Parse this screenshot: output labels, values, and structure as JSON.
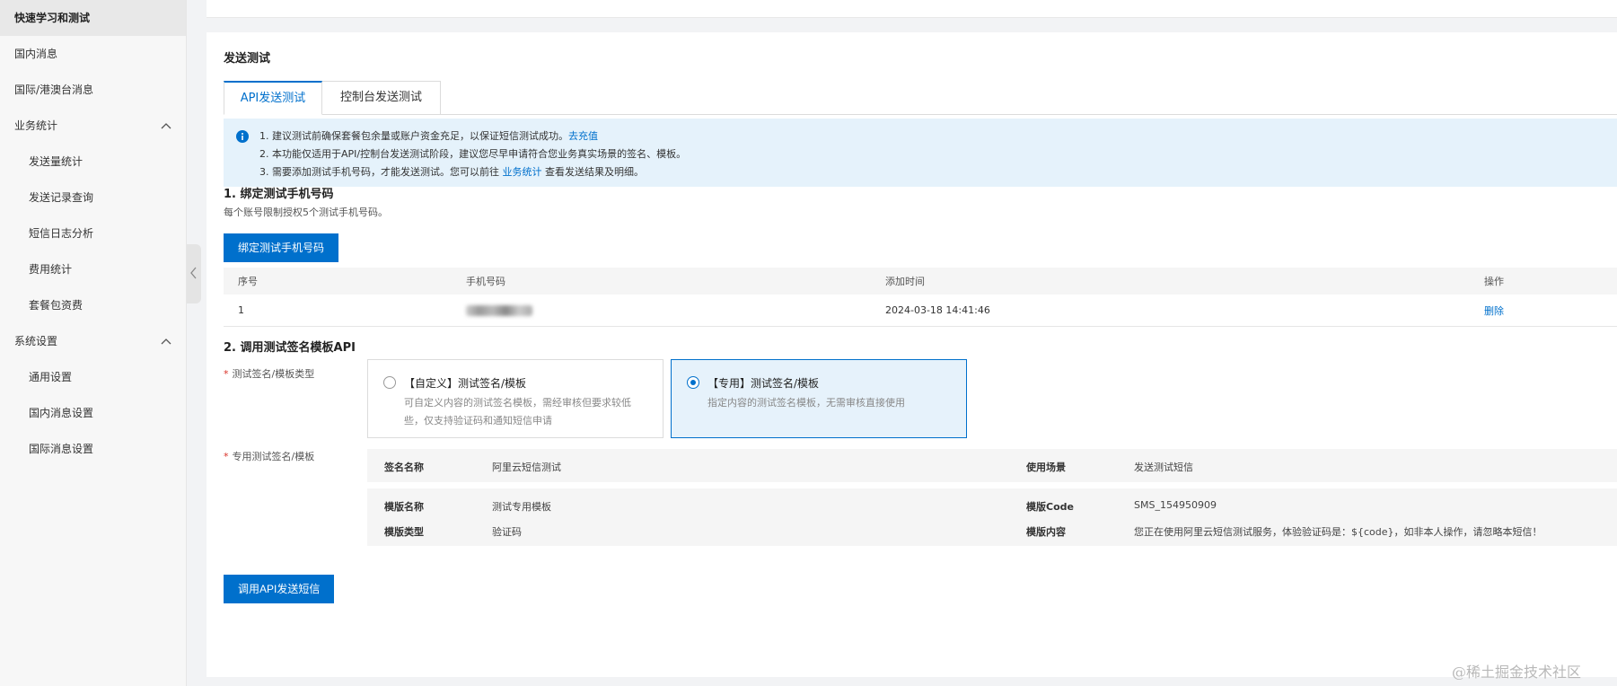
{
  "sidebar": {
    "items": [
      {
        "label": "快速学习和测试"
      },
      {
        "label": "国内消息"
      },
      {
        "label": "国际/港澳台消息"
      },
      {
        "label": "业务统计"
      },
      {
        "label": "发送量统计"
      },
      {
        "label": "发送记录查询"
      },
      {
        "label": "短信日志分析"
      },
      {
        "label": "费用统计"
      },
      {
        "label": "套餐包资费"
      },
      {
        "label": "系统设置"
      },
      {
        "label": "通用设置"
      },
      {
        "label": "国内消息设置"
      },
      {
        "label": "国际消息设置"
      }
    ]
  },
  "main": {
    "title": "发送测试",
    "tabs": [
      {
        "label": "API发送测试"
      },
      {
        "label": "控制台发送测试"
      }
    ],
    "notice": {
      "line1": "1. 建议测试前确保套餐包余量或账户资金充足，以保证短信测试成功。",
      "line1_link": "去充值",
      "line2": "2. 本功能仅适用于API/控制台发送测试阶段，建议您尽早申请符合您业务真实场景的签名、模板。",
      "line3_pre": "3. 需要添加测试手机号码，才能发送测试。您可以前往 ",
      "line3_link": "业务统计",
      "line3_post": " 查看发送结果及明细。"
    },
    "step1": {
      "title": "1. 绑定测试手机号码",
      "desc": "每个账号限制授权5个测试手机号码。",
      "button": "绑定测试手机号码",
      "table": {
        "headers": [
          "序号",
          "手机号码",
          "添加时间",
          "操作"
        ],
        "rows": [
          {
            "index": "1",
            "time": "2024-03-18 14:41:46",
            "action": "删除"
          }
        ]
      }
    },
    "step2": {
      "title": "2. 调用测试签名模板API",
      "type_label": "测试签名/模板类型",
      "options": [
        {
          "title": "【自定义】测试签名/模板",
          "desc_line1": "可自定义内容的测试签名模板，需经审核但要求较低",
          "desc_line2": "些，仅支持验证码和通知短信申请"
        },
        {
          "title": "【专用】测试签名/模板",
          "desc_line1": "指定内容的测试签名模板，无需审核直接使用"
        }
      ],
      "selected_option": 1,
      "template_label": "专用测试签名/模板",
      "template": {
        "sign_name_key": "签名名称",
        "sign_name_value": "阿里云短信测试",
        "scene_key": "使用场景",
        "scene_value": "发送测试短信",
        "tpl_name_key": "模版名称",
        "tpl_name_value": "测试专用模板",
        "tpl_code_key": "模版Code",
        "tpl_code_value": "SMS_154950909",
        "tpl_type_key": "模版类型",
        "tpl_type_value": "验证码",
        "tpl_content_key": "模版内容",
        "tpl_content_value": "您正在使用阿里云短信测试服务，体验验证码是：${code}，如非本人操作，请忽略本短信！"
      },
      "button": "调用API发送短信"
    }
  },
  "watermark": "@稀土掘金技术社区",
  "colors": {
    "primary": "#0070cc",
    "notice_bg": "#e5f2fb",
    "required": "#d93026"
  }
}
